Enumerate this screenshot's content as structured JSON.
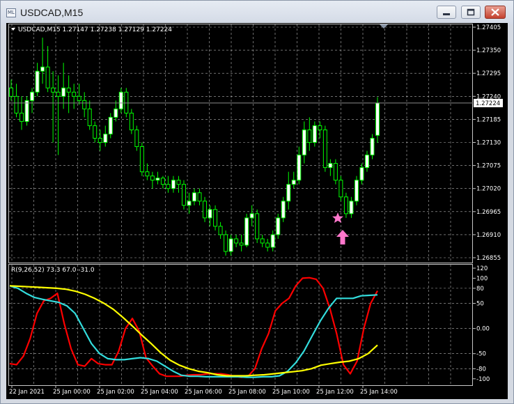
{
  "window": {
    "title": "USDCAD,M15",
    "icon_label": "ML"
  },
  "price_panel": {
    "header": "USDCAD,M15  1.27147 1.27238 1.27129 1.27224",
    "current_price": "1.27224"
  },
  "indicator_panel": {
    "header": "R(9,26,52) 73.3 67.0 -31.0"
  },
  "colors": {
    "background": "#000000",
    "candle": "#00ff00",
    "bull_body": "#ffffff",
    "grid": "#ffffff",
    "series_red": "#ff0000",
    "series_cyan": "#33dddd",
    "series_yellow": "#ffff00",
    "signal": "#ff77cc"
  },
  "chart_data": [
    {
      "type": "candlestick",
      "title": "USDCAD,M15",
      "ylim": [
        1.26855,
        1.27405
      ],
      "y_ticks": [
        "1.27405",
        "1.27350",
        "1.27295",
        "1.27240",
        "1.27185",
        "1.27130",
        "1.27075",
        "1.27020",
        "1.26965",
        "1.26910",
        "1.26855"
      ],
      "x_ticks": [
        "22 Jan 2021",
        "25 Jan 00:00",
        "25 Jan 02:00",
        "25 Jan 04:00",
        "25 Jan 06:00",
        "25 Jan 08:00",
        "25 Jan 10:00",
        "25 Jan 12:00",
        "25 Jan 14:00"
      ],
      "last": {
        "open": 1.27147,
        "high": 1.27238,
        "low": 1.27129,
        "close": 1.27224
      },
      "candles": [
        {
          "o": 1.2726,
          "h": 1.2728,
          "l": 1.2723,
          "c": 1.2724
        },
        {
          "o": 1.2724,
          "h": 1.2727,
          "l": 1.2719,
          "c": 1.272
        },
        {
          "o": 1.272,
          "h": 1.2724,
          "l": 1.2716,
          "c": 1.2718
        },
        {
          "o": 1.2718,
          "h": 1.2724,
          "l": 1.2717,
          "c": 1.2723
        },
        {
          "o": 1.2723,
          "h": 1.2726,
          "l": 1.272,
          "c": 1.2725
        },
        {
          "o": 1.2725,
          "h": 1.2732,
          "l": 1.2724,
          "c": 1.273
        },
        {
          "o": 1.273,
          "h": 1.2738,
          "l": 1.2727,
          "c": 1.2731
        },
        {
          "o": 1.2731,
          "h": 1.2736,
          "l": 1.2725,
          "c": 1.2726
        },
        {
          "o": 1.2726,
          "h": 1.273,
          "l": 1.2713,
          "c": 1.2725
        },
        {
          "o": 1.2725,
          "h": 1.2729,
          "l": 1.271,
          "c": 1.2724
        },
        {
          "o": 1.2724,
          "h": 1.2732,
          "l": 1.2721,
          "c": 1.2726
        },
        {
          "o": 1.2726,
          "h": 1.2729,
          "l": 1.272,
          "c": 1.2725
        },
        {
          "o": 1.2725,
          "h": 1.2727,
          "l": 1.2721,
          "c": 1.2724
        },
        {
          "o": 1.2724,
          "h": 1.2727,
          "l": 1.2722,
          "c": 1.2723
        },
        {
          "o": 1.2723,
          "h": 1.2725,
          "l": 1.2719,
          "c": 1.2721
        },
        {
          "o": 1.2721,
          "h": 1.2723,
          "l": 1.2716,
          "c": 1.2717
        },
        {
          "o": 1.2717,
          "h": 1.2718,
          "l": 1.2713,
          "c": 1.2714
        },
        {
          "o": 1.2714,
          "h": 1.2716,
          "l": 1.2711,
          "c": 1.2713
        },
        {
          "o": 1.2713,
          "h": 1.2717,
          "l": 1.2712,
          "c": 1.2715
        },
        {
          "o": 1.2715,
          "h": 1.272,
          "l": 1.2714,
          "c": 1.2719
        },
        {
          "o": 1.2719,
          "h": 1.2723,
          "l": 1.2718,
          "c": 1.2721
        },
        {
          "o": 1.2721,
          "h": 1.2726,
          "l": 1.272,
          "c": 1.2725
        },
        {
          "o": 1.2725,
          "h": 1.2726,
          "l": 1.2719,
          "c": 1.272
        },
        {
          "o": 1.272,
          "h": 1.2721,
          "l": 1.2715,
          "c": 1.2716
        },
        {
          "o": 1.2716,
          "h": 1.2717,
          "l": 1.2711,
          "c": 1.2712
        },
        {
          "o": 1.2712,
          "h": 1.2713,
          "l": 1.2705,
          "c": 1.2706
        },
        {
          "o": 1.2706,
          "h": 1.2708,
          "l": 1.2704,
          "c": 1.2705
        },
        {
          "o": 1.2705,
          "h": 1.2706,
          "l": 1.2702,
          "c": 1.2704
        },
        {
          "o": 1.2704,
          "h": 1.2706,
          "l": 1.2703,
          "c": 1.27045
        },
        {
          "o": 1.27045,
          "h": 1.2705,
          "l": 1.2702,
          "c": 1.2703
        },
        {
          "o": 1.2703,
          "h": 1.2705,
          "l": 1.2701,
          "c": 1.2702
        },
        {
          "o": 1.2702,
          "h": 1.2705,
          "l": 1.2701,
          "c": 1.2704
        },
        {
          "o": 1.2704,
          "h": 1.2705,
          "l": 1.2701,
          "c": 1.2703
        },
        {
          "o": 1.2703,
          "h": 1.2704,
          "l": 1.2697,
          "c": 1.2698
        },
        {
          "o": 1.2698,
          "h": 1.2701,
          "l": 1.2696,
          "c": 1.2699
        },
        {
          "o": 1.2699,
          "h": 1.2702,
          "l": 1.2698,
          "c": 1.2701
        },
        {
          "o": 1.2701,
          "h": 1.2702,
          "l": 1.2698,
          "c": 1.2699
        },
        {
          "o": 1.2699,
          "h": 1.27,
          "l": 1.2694,
          "c": 1.2695
        },
        {
          "o": 1.2695,
          "h": 1.2698,
          "l": 1.2693,
          "c": 1.2697
        },
        {
          "o": 1.2697,
          "h": 1.2698,
          "l": 1.2692,
          "c": 1.2693
        },
        {
          "o": 1.2693,
          "h": 1.2694,
          "l": 1.269,
          "c": 1.2691
        },
        {
          "o": 1.2691,
          "h": 1.2692,
          "l": 1.2686,
          "c": 1.2687
        },
        {
          "o": 1.2687,
          "h": 1.2691,
          "l": 1.2686,
          "c": 1.269
        },
        {
          "o": 1.269,
          "h": 1.2691,
          "l": 1.2688,
          "c": 1.2689
        },
        {
          "o": 1.2689,
          "h": 1.2691,
          "l": 1.2687,
          "c": 1.26885
        },
        {
          "o": 1.26885,
          "h": 1.2696,
          "l": 1.2688,
          "c": 1.2695
        },
        {
          "o": 1.2695,
          "h": 1.2698,
          "l": 1.2693,
          "c": 1.2696
        },
        {
          "o": 1.2696,
          "h": 1.2697,
          "l": 1.2689,
          "c": 1.269
        },
        {
          "o": 1.269,
          "h": 1.2691,
          "l": 1.2688,
          "c": 1.2689
        },
        {
          "o": 1.2689,
          "h": 1.269,
          "l": 1.2687,
          "c": 1.2688
        },
        {
          "o": 1.2688,
          "h": 1.2692,
          "l": 1.2687,
          "c": 1.2691
        },
        {
          "o": 1.2691,
          "h": 1.2696,
          "l": 1.269,
          "c": 1.2695
        },
        {
          "o": 1.2695,
          "h": 1.27,
          "l": 1.2694,
          "c": 1.2699
        },
        {
          "o": 1.2699,
          "h": 1.2706,
          "l": 1.2697,
          "c": 1.2703
        },
        {
          "o": 1.2703,
          "h": 1.2706,
          "l": 1.2702,
          "c": 1.2704
        },
        {
          "o": 1.2704,
          "h": 1.2712,
          "l": 1.2703,
          "c": 1.271
        },
        {
          "o": 1.271,
          "h": 1.2718,
          "l": 1.2708,
          "c": 1.2716
        },
        {
          "o": 1.2716,
          "h": 1.2719,
          "l": 1.2711,
          "c": 1.2713
        },
        {
          "o": 1.2713,
          "h": 1.2718,
          "l": 1.2712,
          "c": 1.2717
        },
        {
          "o": 1.2717,
          "h": 1.2718,
          "l": 1.2714,
          "c": 1.2716
        },
        {
          "o": 1.2716,
          "h": 1.2717,
          "l": 1.2706,
          "c": 1.2707
        },
        {
          "o": 1.2707,
          "h": 1.2709,
          "l": 1.2705,
          "c": 1.2708
        },
        {
          "o": 1.2708,
          "h": 1.2709,
          "l": 1.2703,
          "c": 1.2704
        },
        {
          "o": 1.2704,
          "h": 1.2705,
          "l": 1.2699,
          "c": 1.27
        },
        {
          "o": 1.27,
          "h": 1.2701,
          "l": 1.2695,
          "c": 1.2696
        },
        {
          "o": 1.2696,
          "h": 1.27,
          "l": 1.2695,
          "c": 1.2699
        },
        {
          "o": 1.2699,
          "h": 1.2705,
          "l": 1.2698,
          "c": 1.2704
        },
        {
          "o": 1.2704,
          "h": 1.2708,
          "l": 1.2703,
          "c": 1.2707
        },
        {
          "o": 1.2707,
          "h": 1.2711,
          "l": 1.2706,
          "c": 1.271
        },
        {
          "o": 1.271,
          "h": 1.2715,
          "l": 1.2709,
          "c": 1.2714
        },
        {
          "o": 1.27147,
          "h": 1.27238,
          "l": 1.27129,
          "c": 1.27224
        }
      ]
    },
    {
      "type": "line",
      "title": "R(9,26,52)",
      "ylim": [
        -110,
        120
      ],
      "y_ticks": [
        "120",
        "100",
        "80",
        "50",
        "0.00",
        "-50",
        "-80",
        "-100"
      ],
      "series": [
        {
          "name": "R9",
          "values": [
            -70,
            -72,
            -55,
            -20,
            30,
            55,
            60,
            70,
            10,
            -40,
            -72,
            -75,
            -60,
            -70,
            -72,
            -72,
            -45,
            0,
            20,
            -5,
            -58,
            -75,
            -90,
            -95,
            -95,
            -95,
            -93,
            -92,
            -92,
            -90,
            -90,
            -90,
            -92,
            -95,
            -97,
            -95,
            -80,
            -40,
            -10,
            35,
            50,
            60,
            85,
            100,
            101,
            98,
            80,
            40,
            -10,
            -72,
            -90,
            -65,
            0,
            50,
            75
          ]
        },
        {
          "name": "R26",
          "values": [
            85,
            80,
            70,
            62,
            58,
            55,
            52,
            45,
            30,
            0,
            -30,
            -50,
            -60,
            -62,
            -62,
            -60,
            -58,
            -60,
            -65,
            -75,
            -85,
            -93,
            -95,
            -95,
            -96,
            -96,
            -96,
            -96,
            -96,
            -97,
            -97,
            -96,
            -96,
            -94,
            -85,
            -68,
            -45,
            -15,
            15,
            40,
            60,
            60,
            60,
            65,
            66,
            67
          ]
        },
        {
          "name": "R52",
          "values": [
            85,
            84,
            83,
            82,
            81,
            80,
            78,
            74,
            68,
            60,
            50,
            38,
            22,
            5,
            -13,
            -30,
            -48,
            -63,
            -73,
            -80,
            -85,
            -88,
            -92,
            -94,
            -94,
            -94,
            -93,
            -92,
            -90,
            -88,
            -86,
            -84,
            -80,
            -73,
            -70,
            -67,
            -65,
            -60,
            -50,
            -33
          ]
        }
      ]
    }
  ]
}
